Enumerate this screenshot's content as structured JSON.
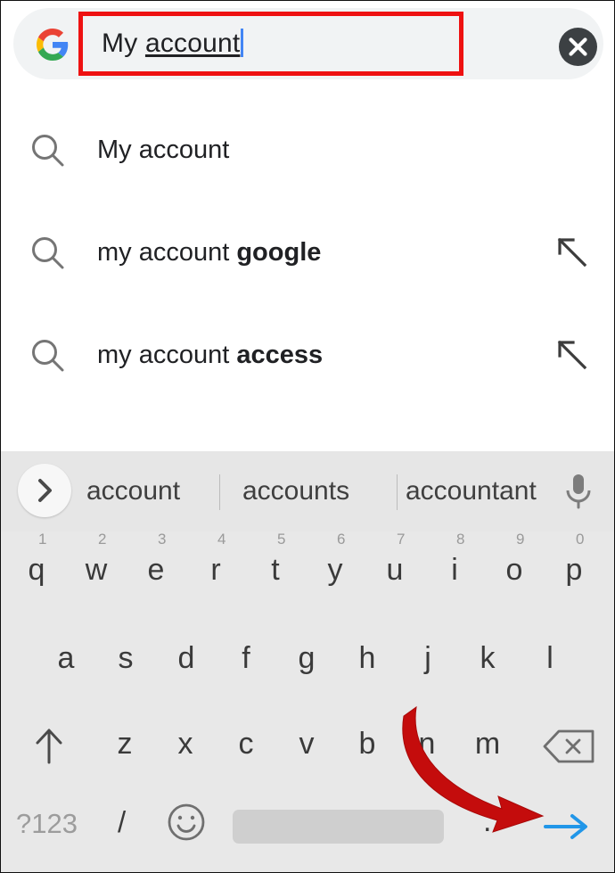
{
  "search_bar": {
    "logo_icon": "google-g-icon",
    "query_prefix": "My ",
    "query_composing": "account",
    "full_query": "My account",
    "clear_icon": "close-circle-icon",
    "highlight_color": "#ee1111",
    "caret_color": "#4285f4"
  },
  "suggestions": {
    "items": [
      {
        "icon": "search-icon",
        "text": "My account",
        "bold": "",
        "arrow_icon": ""
      },
      {
        "icon": "search-icon",
        "text": "my account ",
        "bold": "google",
        "arrow_icon": "arrow-up-left-icon"
      },
      {
        "icon": "search-icon",
        "text": "my account ",
        "bold": "access",
        "arrow_icon": "arrow-up-left-icon"
      }
    ]
  },
  "keyboard": {
    "suggestion_strip": {
      "expand_icon": "chevron-right-icon",
      "words": [
        "account",
        "accounts",
        "accountant"
      ],
      "mic_icon": "microphone-icon"
    },
    "row1": [
      {
        "letter": "q",
        "num": "1"
      },
      {
        "letter": "w",
        "num": "2"
      },
      {
        "letter": "e",
        "num": "3"
      },
      {
        "letter": "r",
        "num": "4"
      },
      {
        "letter": "t",
        "num": "5"
      },
      {
        "letter": "y",
        "num": "6"
      },
      {
        "letter": "u",
        "num": "7"
      },
      {
        "letter": "i",
        "num": "8"
      },
      {
        "letter": "o",
        "num": "9"
      },
      {
        "letter": "p",
        "num": "0"
      }
    ],
    "row2": [
      "a",
      "s",
      "d",
      "f",
      "g",
      "h",
      "j",
      "k",
      "l"
    ],
    "row3": {
      "shift_icon": "shift-arrow-up-icon",
      "letters": [
        "z",
        "x",
        "c",
        "v",
        "b",
        "n",
        "m"
      ],
      "backspace_icon": "backspace-icon"
    },
    "row4": {
      "symbols_label": "?123",
      "slash_label": "/",
      "emoji_icon": "emoji-smiley-icon",
      "space_label": "",
      "period_label": ".",
      "enter_icon": "arrow-right-enter-icon",
      "enter_color": "#2196e8"
    }
  },
  "annotation": {
    "arrow_icon": "curved-arrow-icon",
    "color": "#c40c0c",
    "points_to": "enter-key"
  }
}
